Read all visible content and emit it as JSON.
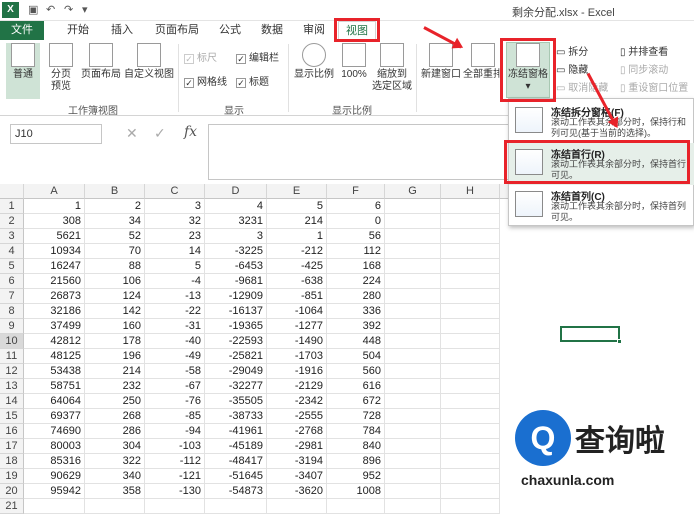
{
  "window": {
    "title": "剩余分配.xlsx - Excel",
    "app_icon": "X"
  },
  "tabs": [
    "文件",
    "开始",
    "插入",
    "页面布局",
    "公式",
    "数据",
    "审阅",
    "视图"
  ],
  "ribbon": {
    "views": {
      "normal": "普通",
      "page_break_1": "分页",
      "page_break_2": "预览",
      "page_layout": "页面布局",
      "custom": "自定义视图",
      "group": "工作簿视图"
    },
    "show": {
      "ruler": "标尺",
      "formula_bar": "编辑栏",
      "gridlines": "网格线",
      "headings": "标题",
      "group": "显示"
    },
    "zoom": {
      "zoom": "显示比例",
      "hundred": "100%",
      "sel_1": "缩放到",
      "sel_2": "选定区域",
      "group": "显示比例"
    },
    "window": {
      "new": "新建窗口",
      "arrange": "全部重排",
      "freeze": "冻结窗格",
      "split": "拆分",
      "hide": "隐藏",
      "unhide": "取消隐藏",
      "side": "并排查看",
      "sync": "同步滚动",
      "reset": "重设窗口位置"
    }
  },
  "formula_bar": {
    "namebox": "J10",
    "fx": "fx"
  },
  "dropdown": [
    {
      "title": "冻结拆分窗格(F)",
      "desc": "滚动工作表其余部分时，保持行和列可见(基于当前的选择)。"
    },
    {
      "title": "冻结首行(R)",
      "desc": "滚动工作表其余部分时，保持首行可见。"
    },
    {
      "title": "冻结首列(C)",
      "desc": "滚动工作表其余部分时，保持首列可见。"
    }
  ],
  "grid": {
    "columns": [
      "A",
      "B",
      "C",
      "D",
      "E",
      "F",
      "G",
      "H"
    ],
    "rows": [
      [
        "1",
        "2",
        "3",
        "4",
        "5",
        "6"
      ],
      [
        "308",
        "34",
        "32",
        "3231",
        "214",
        "0"
      ],
      [
        "5621",
        "52",
        "23",
        "3",
        "1",
        "56"
      ],
      [
        "10934",
        "70",
        "14",
        "-3225",
        "-212",
        "112"
      ],
      [
        "16247",
        "88",
        "5",
        "-6453",
        "-425",
        "168"
      ],
      [
        "21560",
        "106",
        "-4",
        "-9681",
        "-638",
        "224"
      ],
      [
        "26873",
        "124",
        "-13",
        "-12909",
        "-851",
        "280"
      ],
      [
        "32186",
        "142",
        "-22",
        "-16137",
        "-1064",
        "336"
      ],
      [
        "37499",
        "160",
        "-31",
        "-19365",
        "-1277",
        "392"
      ],
      [
        "42812",
        "178",
        "-40",
        "-22593",
        "-1490",
        "448"
      ],
      [
        "48125",
        "196",
        "-49",
        "-25821",
        "-1703",
        "504"
      ],
      [
        "53438",
        "214",
        "-58",
        "-29049",
        "-1916",
        "560"
      ],
      [
        "58751",
        "232",
        "-67",
        "-32277",
        "-2129",
        "616"
      ],
      [
        "64064",
        "250",
        "-76",
        "-35505",
        "-2342",
        "672"
      ],
      [
        "69377",
        "268",
        "-85",
        "-38733",
        "-2555",
        "728"
      ],
      [
        "74690",
        "286",
        "-94",
        "-41961",
        "-2768",
        "784"
      ],
      [
        "80003",
        "304",
        "-103",
        "-45189",
        "-2981",
        "840"
      ],
      [
        "85316",
        "322",
        "-112",
        "-48417",
        "-3194",
        "896"
      ],
      [
        "90629",
        "340",
        "-121",
        "-51645",
        "-3407",
        "952"
      ],
      [
        "95942",
        "358",
        "-130",
        "-54873",
        "-3620",
        "1008"
      ],
      [
        "",
        "",
        "",
        "",
        "",
        ""
      ]
    ]
  },
  "watermark": {
    "brand": "查询啦",
    "url": "chaxunla.com",
    "logo": "Q"
  },
  "colors": {
    "excel_green": "#217346",
    "annotation_red": "#e8232a"
  }
}
